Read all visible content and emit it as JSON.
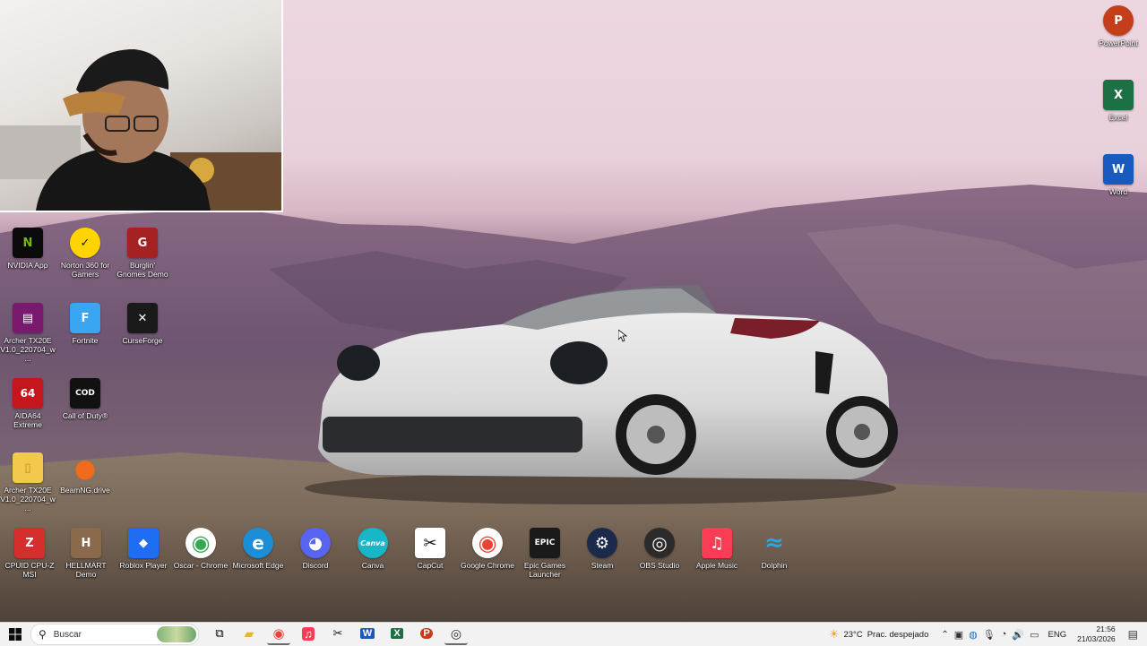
{
  "desktop_icons": [
    {
      "label": "NVIDIA App",
      "icon": "nvidia-icon",
      "color": "#0b0b0b",
      "glyph": "N"
    },
    {
      "label": "Norton 360 for Gamers",
      "icon": "norton-icon",
      "color": "#ffd400",
      "glyph": "✓"
    },
    {
      "label": "Burglin' Gnomes Demo",
      "icon": "burglin-gnomes-icon",
      "color": "#a52222",
      "glyph": "G"
    },
    {
      "label": "Archer TX20E V1.0_220704_w...",
      "icon": "winrar-icon",
      "color": "#7a1a6e",
      "glyph": "▤"
    },
    {
      "label": "Fortnite",
      "icon": "fortnite-icon",
      "color": "#3aa5f0",
      "glyph": "F"
    },
    {
      "label": "CurseForge",
      "icon": "curseforge-icon",
      "color": "#1a1a1a",
      "glyph": "✕"
    },
    {
      "label": "AIDA64 Extreme",
      "icon": "aida64-icon",
      "color": "#c4161c",
      "glyph": "64"
    },
    {
      "label": "Call of Duty®",
      "icon": "call-of-duty-icon",
      "color": "#111111",
      "glyph": "COD"
    },
    {
      "label": "Archer TX20E V1.0_220704_w...",
      "icon": "folder-icon",
      "color": "#f2c94c",
      "glyph": "▯"
    },
    {
      "label": "BeamNG.drive",
      "icon": "beamng-icon",
      "color": "#f26a1b",
      "glyph": "●"
    }
  ],
  "bottom_row_icons": [
    {
      "label": "CPUID CPU-Z MSI",
      "icon": "cpuz-icon",
      "color": "#d62d2d",
      "glyph": "Z"
    },
    {
      "label": "HELLMART Demo",
      "icon": "hellmart-icon",
      "color": "#8a6a4a",
      "glyph": "H"
    },
    {
      "label": "Roblox Player",
      "icon": "roblox-icon",
      "color": "#1e6df2",
      "glyph": "◆"
    },
    {
      "label": "Oscar - Chrome",
      "icon": "chrome-profile-icon",
      "color": "#34a853",
      "glyph": "◉"
    },
    {
      "label": "Microsoft Edge",
      "icon": "edge-icon",
      "color": "#1b8ed6",
      "glyph": "e"
    },
    {
      "label": "Discord",
      "icon": "discord-icon",
      "color": "#5865f2",
      "glyph": "◕"
    },
    {
      "label": "Canva",
      "icon": "canva-icon",
      "color": "#18b6c6",
      "glyph": "Canva"
    },
    {
      "label": "CapCut",
      "icon": "capcut-icon",
      "color": "#ffffff",
      "glyph": "✂"
    },
    {
      "label": "Google Chrome",
      "icon": "chrome-icon",
      "color": "#ea4335",
      "glyph": "◉"
    },
    {
      "label": "Epic Games Launcher",
      "icon": "epic-games-icon",
      "color": "#1a1a1a",
      "glyph": "EPIC"
    },
    {
      "label": "Steam",
      "icon": "steam-icon",
      "color": "#1b2a4a",
      "glyph": "⚙"
    },
    {
      "label": "OBS Studio",
      "icon": "obs-icon",
      "color": "#2b2b2b",
      "glyph": "◎"
    },
    {
      "label": "Apple Music",
      "icon": "apple-music-icon",
      "color": "#fa3c55",
      "glyph": "♫"
    },
    {
      "label": "Dolphin",
      "icon": "dolphin-icon",
      "color": "#2aa7e0",
      "glyph": "≈"
    }
  ],
  "right_icons": [
    {
      "label": "PowerPoint",
      "icon": "powerpoint-icon",
      "color": "#c43e1c",
      "glyph": "P"
    },
    {
      "label": "Excel",
      "icon": "excel-icon",
      "color": "#1d7044",
      "glyph": "X"
    },
    {
      "label": "Word",
      "icon": "word-icon",
      "color": "#185abd",
      "glyph": "W"
    }
  ],
  "taskbar": {
    "search_placeholder": "Buscar",
    "pinned": [
      {
        "icon": "task-view-icon",
        "glyph": "⧉",
        "color": "#333333"
      },
      {
        "icon": "file-explorer-icon",
        "glyph": "▰",
        "color": "#e8b33a"
      },
      {
        "icon": "chrome-taskbar-icon",
        "glyph": "◉",
        "color": "#ea4335"
      },
      {
        "icon": "apple-music-taskbar-icon",
        "glyph": "♫",
        "color": "#fa3c55"
      },
      {
        "icon": "capcut-taskbar-icon",
        "glyph": "✂",
        "color": "#111111"
      },
      {
        "icon": "word-taskbar-icon",
        "glyph": "W",
        "color": "#185abd"
      },
      {
        "icon": "excel-taskbar-icon",
        "glyph": "X",
        "color": "#1d7044"
      },
      {
        "icon": "powerpoint-taskbar-icon",
        "glyph": "P",
        "color": "#c43e1c"
      },
      {
        "icon": "obs-taskbar-icon",
        "glyph": "◎",
        "color": "#2b2b2b"
      }
    ],
    "weather_temp": "23°C",
    "weather_desc": "Prac. despejado",
    "language": "ENG",
    "time": "21:56",
    "date": "21/03/2026"
  }
}
